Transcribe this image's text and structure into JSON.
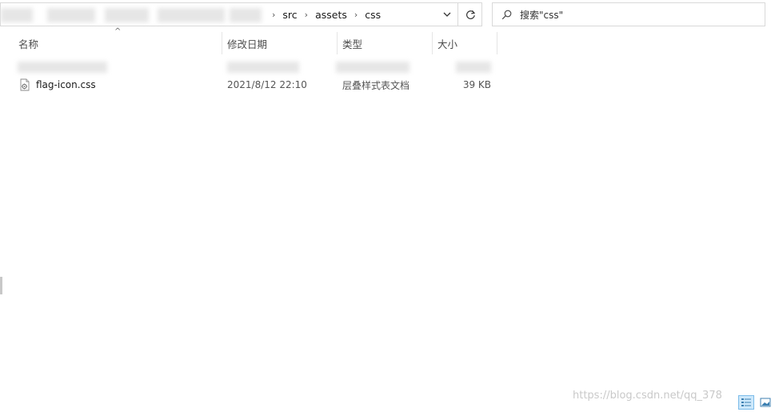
{
  "address_bar": {
    "breadcrumbs": [
      "src",
      "assets",
      "css"
    ]
  },
  "search": {
    "value": "搜索\"css\""
  },
  "columns": {
    "name": "名称",
    "modified": "修改日期",
    "type": "类型",
    "size": "大小"
  },
  "files": [
    {
      "name": "flag-icon.css",
      "modified": "2021/8/12 22:10",
      "type": "层叠样式表文档",
      "size": "39 KB",
      "icon": "css-file-icon"
    }
  ],
  "watermark": "https://blog.csdn.net/qq_378",
  "icons": {
    "dropdown": "chevron-down-icon",
    "refresh": "refresh-icon",
    "search": "search-icon",
    "details_view": "details-view-icon",
    "large_icons_view": "large-icons-view-icon"
  },
  "colors": {
    "accent": "#0078d7",
    "active_view_bg": "#cde8fb",
    "active_view_border": "#7cbcea"
  }
}
